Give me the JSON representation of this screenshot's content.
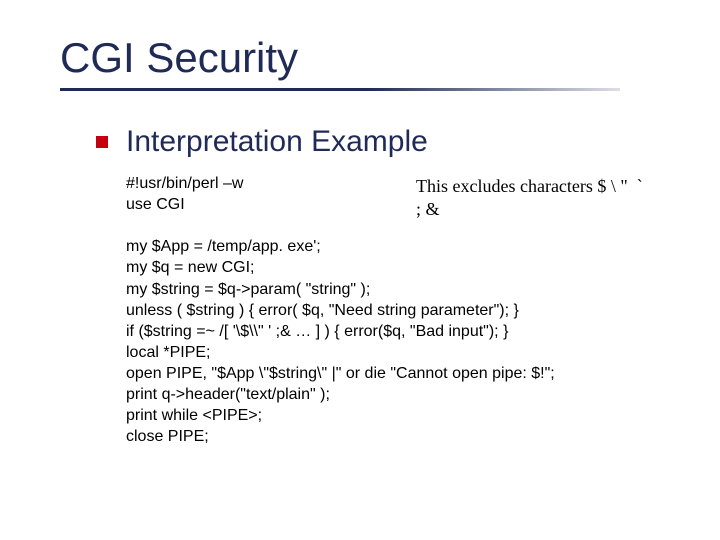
{
  "slide": {
    "title": "CGI Security",
    "subtitle": "Interpretation Example",
    "code_intro": "#!usr/bin/perl –w\nuse CGI",
    "note": "This excludes characters $ \\ \"  `\n; &",
    "code_body": "\nmy $App = /temp/app. exe';\nmy $q = new CGI;\nmy $string = $q->param( \"string\" );\nunless ( $string ) { error( $q, \"Need string parameter\"); }\nif ($string =~ /[ '\\$\\\\\" ' ;& … ] ) { error($q, \"Bad input\"); }\nlocal *PIPE;\nopen PIPE, \"$App \\\"$string\\\" |\" or die \"Cannot open pipe: $!\";\nprint q->header(\"text/plain\" );\nprint while <PIPE>;\nclose PIPE;"
  }
}
